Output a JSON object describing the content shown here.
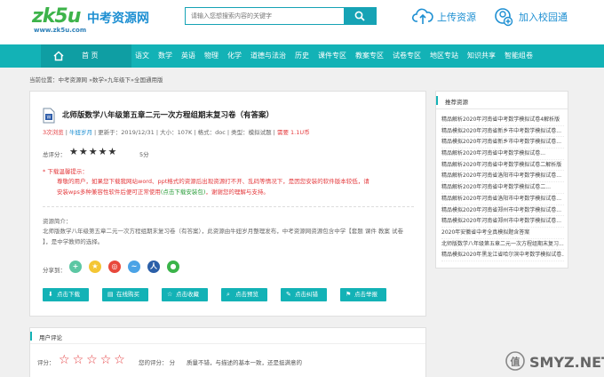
{
  "header": {
    "logo_mark": "zk5u",
    "logo_title": "中考资源网",
    "logo_url": "www.zk5u.com",
    "search_placeholder": "请输入您想搜索内容的关键字",
    "upload_label": "上传资源",
    "join_label": "加入校园通"
  },
  "nav": {
    "home_label": "首 页",
    "items": [
      "语文",
      "数学",
      "英语",
      "物理",
      "化学",
      "道德与法治",
      "历史",
      "课件专区",
      "教案专区",
      "试卷专区",
      "地区专站",
      "知识共享",
      "智能组卷"
    ]
  },
  "breadcrumb": "当前位置：中考资源网 »数学»九年级下»全国通用版",
  "doc": {
    "title": "北师版数学八年级第五章二元一次方程组期末复习卷（有答案）",
    "views": "3次浏览",
    "author": "牛妞岁月",
    "updated": "更新于：2019/12/31",
    "size": "大小：107K",
    "format": "格式：doc",
    "type": "类型：模拟试题",
    "cost": "需要 1.1U币",
    "score_label": "总评分：",
    "score_value": "5分",
    "tips_title": "* 下载温馨提示：",
    "tips_line1": "尊敬的用户，如果您下载我网站word、ppt格式的资源后出现资源打不开、乱码等情况下，是因您安装的软件版本较低，请",
    "tips_line2a": "安装wps多种兼容性软件后便可正常使用",
    "tips_line2b": "(点击下载安装包)",
    "tips_line2c": "，谢谢您的理解与支持。",
    "intro_label": "资源简介：",
    "intro_line1": "北师版数学八年级第五章二元一次方程组期末复习卷（有答案），此资源由牛妞岁月整理发布，中考资源网资源包含中学【套题 课件 教案 试卷",
    "intro_line2": "】，是中学教师的选择。",
    "share_label": "分享到："
  },
  "actions": [
    "点击下载",
    "在线购买",
    "点击收藏",
    "点击预览",
    "点击纠错",
    "点击举报"
  ],
  "sidebar": {
    "title": "推荐资源",
    "items": [
      "精品解析2020年河南省中考数学模拟试卷4解析版",
      "精品模拟2020年河南省新乡市中考数学模拟试卷...",
      "精品模拟2020年河南省新乡市中考数学模拟试卷...",
      "精品解析2020年河南省中考数学模拟试卷...",
      "精品解析2020年河南省中考数学模拟试卷二解析版",
      "精品解析2020年河南省洛阳市中考数学模拟试卷...",
      "精品解析2020年河南省中考数学模拟试卷二...",
      "精品解析2020年河南省洛阳市中考数学模拟试卷...",
      "精品模拟2020年河南省郑州市中考数学模拟试卷...",
      "精品模拟2020年河南省郑州市中考数学模拟试卷...",
      "2020年安徽省中考全真模拟题含答案",
      "北师版数学八年级第五章二元一次方程组期末复习...",
      "精品模拟2020年黑龙江省哈尔滨中考数学模拟试卷..."
    ]
  },
  "comment": {
    "title": "用户评论",
    "score_label": "评分：",
    "mine": "您的评分： 分",
    "hint": "质量不错，与描述的基本一致，还是挺满意的"
  },
  "watermark": "SMYZ.NET"
}
